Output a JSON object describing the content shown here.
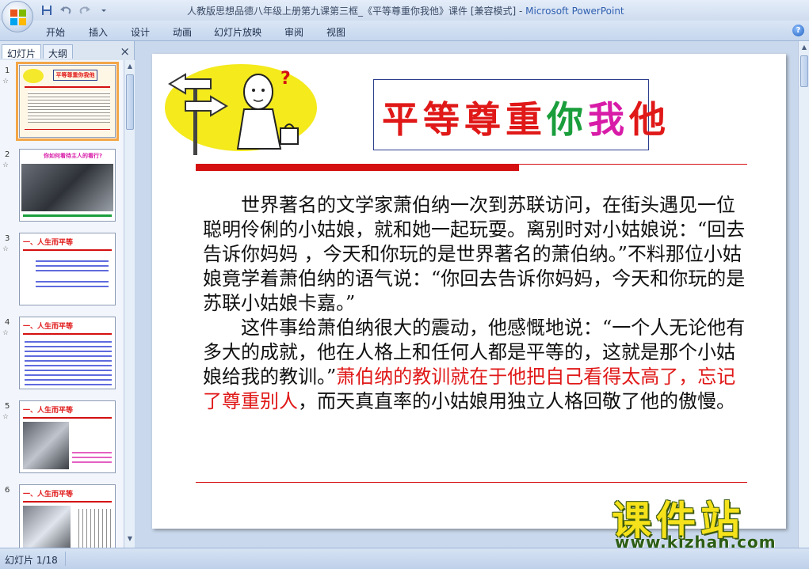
{
  "window": {
    "title": "人教版思想品德八年级上册第九课第三框_《平等尊重你我他》课件 [兼容模式] - ",
    "app_name": "Microsoft PowerPoint"
  },
  "ribbon": {
    "tabs": [
      "开始",
      "插入",
      "设计",
      "动画",
      "幻灯片放映",
      "审阅",
      "视图"
    ]
  },
  "left_pane": {
    "tab_slides": "幻灯片",
    "tab_outline": "大纲",
    "close": "×",
    "thumbnails": [
      {
        "num": "1",
        "title": "平等尊重你我他"
      },
      {
        "num": "2",
        "title": "你如何看待主人的看行?"
      },
      {
        "num": "3",
        "title": "一、人生而平等"
      },
      {
        "num": "4",
        "title": "一、人生而平等"
      },
      {
        "num": "5",
        "title": "一、人生而平等"
      },
      {
        "num": "6",
        "title": "一、人生而平等"
      }
    ]
  },
  "slide": {
    "title_chars": [
      {
        "ch": "平",
        "color": "#e01818"
      },
      {
        "ch": "等",
        "color": "#e01818"
      },
      {
        "ch": "尊",
        "color": "#e01818"
      },
      {
        "ch": "重",
        "color": "#e01818"
      },
      {
        "ch": "你",
        "color": "#1a9e3c"
      },
      {
        "ch": "我",
        "color": "#d81ca8"
      },
      {
        "ch": "他",
        "color": "#e01818"
      }
    ],
    "para1": "世界著名的文学家萧伯纳一次到苏联访问，在街头遇见一位聪明伶俐的小姑娘，就和她一起玩耍。离别时对小姑娘说：“回去告诉你妈妈 ，今天和你玩的是世界著名的萧伯纳。”不料那位小姑娘竟学着萧伯纳的语气说：“你回去告诉你妈妈，今天和你玩的是苏联小姑娘卡嘉。”",
    "para2_a": "这件事给萧伯纳很大的震动，他感慨地说：“一个人无论他有多大的成就，他在人格上和任何人都是平等的，这就是那个小姑娘给我的教训。”",
    "para2_red": "萧伯纳的教训就在于他把自己看得太高了，忘记了尊重别人",
    "para2_b": "，而天真直率的小姑娘用独立人格回敬了他的傲慢。"
  },
  "watermark": {
    "big": "课件站",
    "small": "www.kjzhan.com"
  },
  "status": {
    "slide_counter": "幻灯片 1/18"
  }
}
